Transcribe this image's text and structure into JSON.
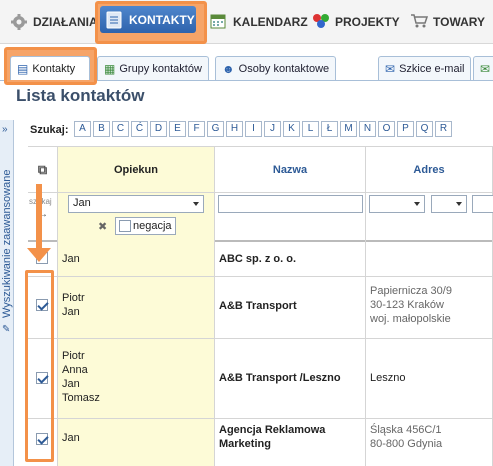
{
  "topnav": {
    "items": [
      {
        "label": "DZIAŁANIA",
        "icon": "gear-icon"
      },
      {
        "label": "KONTAKTY",
        "icon": "contacts-icon",
        "active": true
      },
      {
        "label": "KALENDARZ",
        "icon": "calendar-icon"
      },
      {
        "label": "PROJEKTY",
        "icon": "projects-icon"
      },
      {
        "label": "TOWARY",
        "icon": "cart-icon"
      }
    ]
  },
  "subtabs": {
    "items": [
      {
        "label": "Kontakty",
        "active": true
      },
      {
        "label": "Grupy kontaktów"
      },
      {
        "label": "Osoby kontaktowe"
      },
      {
        "label": "Szkice e-mail"
      }
    ]
  },
  "page": {
    "title": "Lista kontaktów"
  },
  "side_panel": {
    "label": "Wyszukiwanie zaawansowane",
    "chevron": "»"
  },
  "alphabet": {
    "label": "Szukaj:",
    "letters": [
      "A",
      "B",
      "C",
      "Ć",
      "D",
      "E",
      "F",
      "G",
      "H",
      "I",
      "J",
      "K",
      "L",
      "Ł",
      "M",
      "N",
      "O",
      "P",
      "Q",
      "R"
    ]
  },
  "table": {
    "columns": {
      "opiekun": "Opiekun",
      "nazwa": "Nazwa",
      "adres": "Adres"
    },
    "filter": {
      "search_label": "szukaj",
      "opiekun_value": "Jan",
      "negacja_label": "negacja"
    },
    "rows": [
      {
        "checked": false,
        "opiekun": [
          "Jan"
        ],
        "nazwa": "ABC sp. z o. o.",
        "adres": []
      },
      {
        "checked": true,
        "opiekun": [
          "Piotr",
          "Jan"
        ],
        "nazwa": "A&B Transport",
        "adres": [
          "Papiernicza 30/9",
          "30-123 Kraków",
          "woj. małopolskie"
        ]
      },
      {
        "checked": true,
        "opiekun": [
          "Piotr",
          "Anna",
          "Jan",
          "Tomasz"
        ],
        "nazwa": "A&B Transport /Leszno",
        "adres": [
          "Leszno"
        ]
      },
      {
        "checked": true,
        "opiekun": [
          "Jan"
        ],
        "nazwa": "Agencja Reklamowa Marketing",
        "adres": [
          "Śląska 456C/1",
          "80-800 Gdynia"
        ]
      }
    ]
  },
  "colors": {
    "accent": "#f39149",
    "nav_blue": "#2e63ad",
    "row_yellow": "#fdfbd7",
    "link_blue": "#2d5a96"
  }
}
